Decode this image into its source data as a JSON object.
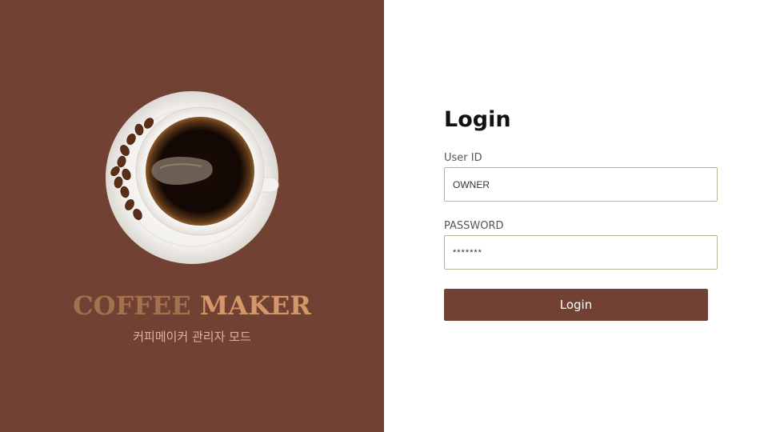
{
  "brand": {
    "title_part1": "COFFEE",
    "title_part2": "MAKER",
    "subtitle": "커피메이커 관리자 모드",
    "colors": {
      "panel_background": "#714233",
      "title_part1": "#a4714f",
      "title_part2": "#d49767",
      "subtitle": "#d8b7a2"
    },
    "image": "coffee-cup-with-beans-top-view"
  },
  "login": {
    "title": "Login",
    "user_id": {
      "label": "User ID",
      "value": "OWNER"
    },
    "password": {
      "label": "PASSWORD",
      "value": "*******"
    },
    "button_label": "Login",
    "colors": {
      "button_background": "#714233",
      "button_text": "#ffffff",
      "field_border": "#b8b49a"
    }
  }
}
